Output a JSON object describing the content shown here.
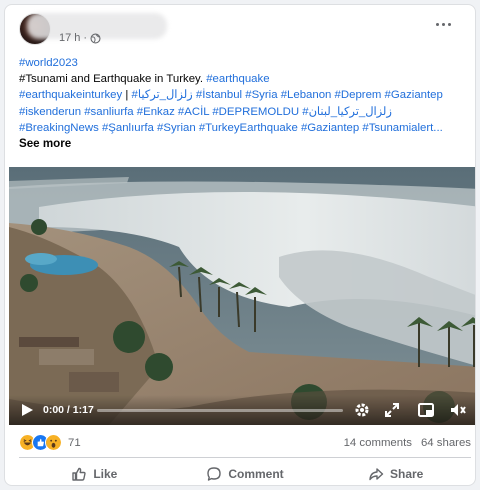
{
  "post": {
    "timestamp": "17 h",
    "privacy_icon": "globe-icon",
    "more_icon": "more-options-icon",
    "lines": [
      [
        {
          "t": "link",
          "v": "#world2023"
        }
      ],
      [
        {
          "t": "text",
          "v": "#Tsunami and Earthquake in Turkey. "
        },
        {
          "t": "link",
          "v": "#earthquake"
        }
      ],
      [
        {
          "t": "link",
          "v": "#earthquakeinturkey"
        },
        {
          "t": "text",
          "v": " | "
        },
        {
          "t": "link",
          "v": "#زلزال_تركيا"
        },
        {
          "t": "text",
          "v": "  "
        },
        {
          "t": "link",
          "v": "#İstanbul #Syria #Lebanon #Deprem #Gaziantep"
        }
      ],
      [
        {
          "t": "link",
          "v": "#iskenderun #sanliurfa #Enkaz #ACİL  #DEPREMOLDU  #زلزال_تركيا_لبنان"
        }
      ],
      [
        {
          "t": "link",
          "v": "#BreakingNews #Şanlıurfa #Syrian #TurkeyEarthquake  #Gaziantep #Tsunamialert..."
        }
      ]
    ],
    "see_more": "See more"
  },
  "video": {
    "time": "0:00 / 1:17",
    "progress_fraction": 0.0,
    "controls": [
      "play-icon",
      "settings-gear-icon",
      "fullscreen-expand-icon",
      "picture-in-picture-icon",
      "volume-muted-icon"
    ]
  },
  "reactions": {
    "count": "71",
    "comments": "14 comments",
    "shares": "64 shares"
  },
  "actions": {
    "like": "Like",
    "comment": "Comment",
    "share": "Share"
  },
  "colors": {
    "link": "#216fdb",
    "muted": "#65676b",
    "like_blue": "#1877f2",
    "haha_yellow": "#f7b125"
  }
}
